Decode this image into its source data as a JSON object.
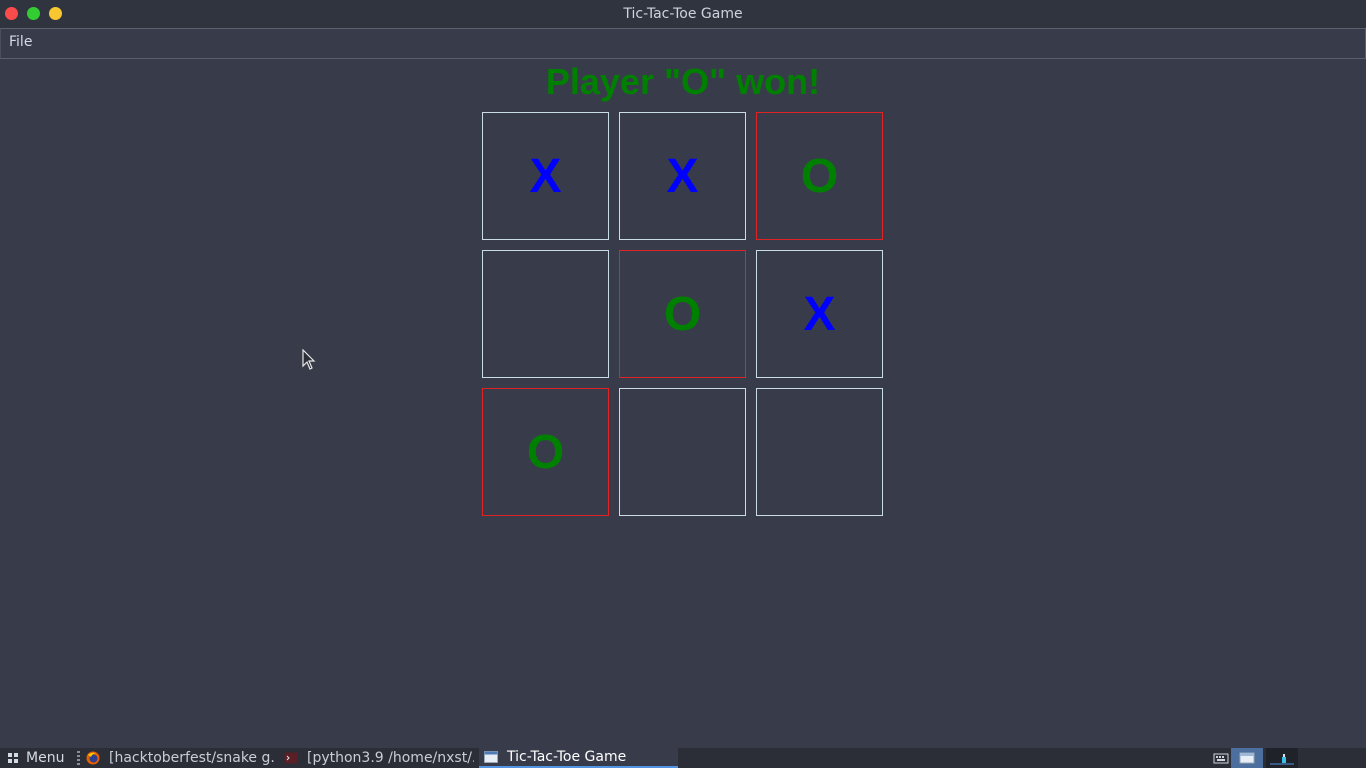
{
  "window": {
    "title": "Tic-Tac-Toe Game"
  },
  "menubar": {
    "items": [
      "File"
    ]
  },
  "game": {
    "status": "Player \"O\" won!",
    "board": [
      "X",
      "X",
      "O",
      "",
      "O",
      "X",
      "O",
      "",
      ""
    ],
    "winning_cells": [
      2,
      4,
      6
    ],
    "colors": {
      "x": "#0000ff",
      "o": "#008000",
      "win_border": "#e02424",
      "cell_border": "#c8dbe6"
    }
  },
  "taskbar": {
    "menu_label": "Menu",
    "tasks": [
      {
        "label": "[hacktoberfest/snake g...",
        "icon": "firefox-icon",
        "active": false
      },
      {
        "label": "[python3.9 /home/nxst/...",
        "icon": "terminal-icon",
        "active": false
      },
      {
        "label": "Tic-Tac-Toe Game",
        "icon": "window-icon",
        "active": true
      }
    ],
    "tray_icons": [
      "keyboard-icon",
      "window-switch-icon",
      "network-icon"
    ]
  }
}
